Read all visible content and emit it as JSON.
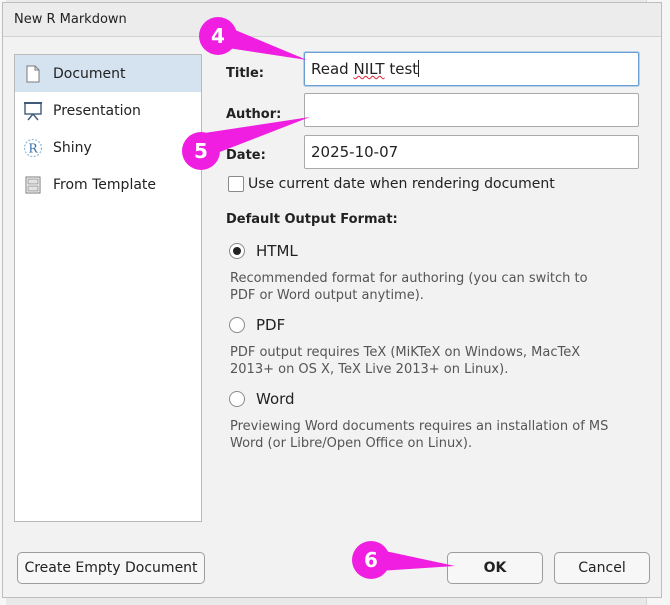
{
  "dialog": {
    "title": "New R Markdown"
  },
  "sidebar": {
    "items": [
      {
        "label": "Document",
        "icon": "document-icon",
        "selected": true
      },
      {
        "label": "Presentation",
        "icon": "presentation-icon",
        "selected": false
      },
      {
        "label": "Shiny",
        "icon": "shiny-r-icon",
        "selected": false
      },
      {
        "label": "From Template",
        "icon": "template-icon",
        "selected": false
      }
    ]
  },
  "form": {
    "title_label": "Title:",
    "title_value": "Read NILT test",
    "title_value_prefix": "Read ",
    "title_value_misspelled": "NILT",
    "title_value_suffix": " test",
    "author_label": "Author:",
    "author_value": "",
    "date_label": "Date:",
    "date_value": "2025-10-07",
    "use_current_date_label": "Use current date when rendering document",
    "use_current_date_checked": false
  },
  "output_format": {
    "heading": "Default Output Format:",
    "selected": "HTML",
    "options": [
      {
        "label": "HTML",
        "description_line1": "Recommended format for authoring (you can switch to",
        "description_line2": "PDF or Word output anytime)."
      },
      {
        "label": "PDF",
        "description_line1": "PDF output requires TeX (MiKTeX on Windows, MacTeX",
        "description_line2": "2013+ on OS X, TeX Live 2013+ on Linux)."
      },
      {
        "label": "Word",
        "description_line1": "Previewing Word documents requires an installation of MS",
        "description_line2": "Word (or Libre/Open Office on Linux)."
      }
    ]
  },
  "buttons": {
    "create_empty": "Create Empty Document",
    "ok": "OK",
    "cancel": "Cancel"
  },
  "annotations": {
    "color": "#f01ee0",
    "markers": [
      "4",
      "5",
      "6"
    ]
  }
}
